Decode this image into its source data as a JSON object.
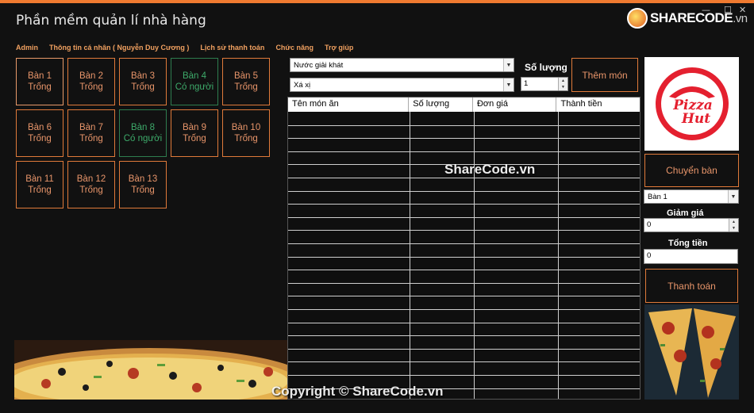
{
  "app": {
    "title": "Phần mềm quản lí nhà hàng"
  },
  "window_controls": {
    "minimize": "—",
    "maximize": "☐",
    "close": "✕"
  },
  "logo": {
    "brand": "SHARECODE",
    "suffix": ".vn"
  },
  "menu": [
    {
      "label": "Admin"
    },
    {
      "label": "Thông tin cá nhân ( Nguyễn Duy Cương )"
    },
    {
      "label": "Lịch sử thanh toán"
    },
    {
      "label": "Chức năng"
    },
    {
      "label": "Trợ giúp"
    }
  ],
  "tables": [
    {
      "name": "Bàn 1",
      "status": "Trống",
      "busy": false
    },
    {
      "name": "Bàn 2",
      "status": "Trống",
      "busy": false
    },
    {
      "name": "Bàn 3",
      "status": "Trống",
      "busy": false
    },
    {
      "name": "Bàn 4",
      "status": "Có người",
      "busy": true
    },
    {
      "name": "Bàn 5",
      "status": "Trống",
      "busy": false
    },
    {
      "name": "Bàn 6",
      "status": "Trống",
      "busy": false
    },
    {
      "name": "Bàn 7",
      "status": "Trống",
      "busy": false
    },
    {
      "name": "Bàn 8",
      "status": "Có người",
      "busy": true
    },
    {
      "name": "Bàn 9",
      "status": "Trống",
      "busy": false
    },
    {
      "name": "Bàn 10",
      "status": "Trống",
      "busy": false
    },
    {
      "name": "Bàn 11",
      "status": "Trống",
      "busy": false
    },
    {
      "name": "Bàn 12",
      "status": "Trống",
      "busy": false
    },
    {
      "name": "Bàn 13",
      "status": "Trống",
      "busy": false
    }
  ],
  "order": {
    "category_value": "Nước giải khát",
    "food_value": "Xá xị",
    "quantity_label": "Số lượng",
    "quantity_value": "1",
    "add_button": "Thêm món"
  },
  "bill_grid": {
    "columns": [
      "Tên món ăn",
      "Số lượng",
      "Đơn giá",
      "Thành tiền"
    ],
    "rows": []
  },
  "side": {
    "pizzahut_text_1": "Pizza",
    "pizzahut_text_2": "Hut",
    "switch_button": "Chuyển bàn",
    "switch_table_value": "Bàn 1",
    "discount_label": "Giảm giá",
    "discount_value": "0",
    "total_label": "Tổng tiền",
    "total_value": "0",
    "pay_button": "Thanh toán"
  },
  "watermarks": {
    "center": "ShareCode.vn",
    "bottom": "Copyright © ShareCode.vn"
  },
  "colors": {
    "accent": "#e07a3a",
    "busy": "#3daa6a",
    "background": "#111111",
    "top_bar": "#f07a30"
  }
}
